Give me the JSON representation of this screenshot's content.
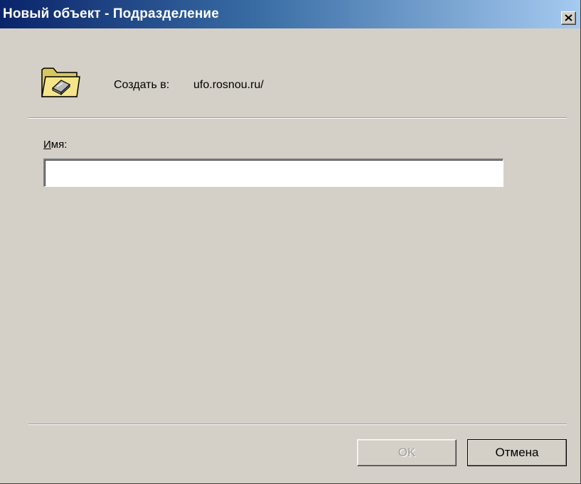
{
  "window": {
    "title": "Новый объект - Подразделение",
    "close_glyph": "✕"
  },
  "header": {
    "icon": "folder-icon",
    "create_label": "Создать в:",
    "create_value": "ufo.rosnou.ru/"
  },
  "form": {
    "name_label_accel": "И",
    "name_label_rest": "мя:",
    "name_value": "",
    "name_placeholder": ""
  },
  "buttons": {
    "ok_label": "OK",
    "cancel_label": "Отмена"
  },
  "colors": {
    "dialog_face": "#d4d0c8",
    "title_start": "#0a246a",
    "title_end": "#a6caf0",
    "disabled_text": "#a0a09c"
  }
}
